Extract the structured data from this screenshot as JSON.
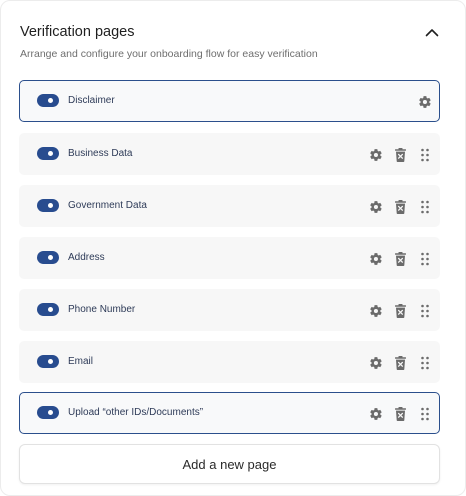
{
  "header": {
    "title": "Verification pages",
    "subtitle": "Arrange and configure your onboarding flow for easy verification"
  },
  "pages": [
    {
      "label": "Disclaimer",
      "enabled": true
    },
    {
      "label": "Business Data",
      "enabled": true
    },
    {
      "label": "Government Data",
      "enabled": true
    },
    {
      "label": "Address",
      "enabled": true
    },
    {
      "label": "Phone Number",
      "enabled": true
    },
    {
      "label": "Email",
      "enabled": true
    },
    {
      "label": "Upload “other IDs/Documents”",
      "enabled": true
    }
  ],
  "add_button_label": "Add a new page",
  "colors": {
    "toggle": "#284c8f",
    "selected_border": "#2b4f8c",
    "row_bg": "#f7f7f7",
    "icon": "#6b6b6b"
  },
  "icons": {
    "collapse": "chevron-up-icon",
    "settings": "gear-icon",
    "delete": "trash-icon",
    "drag": "drag-handle-icon"
  }
}
